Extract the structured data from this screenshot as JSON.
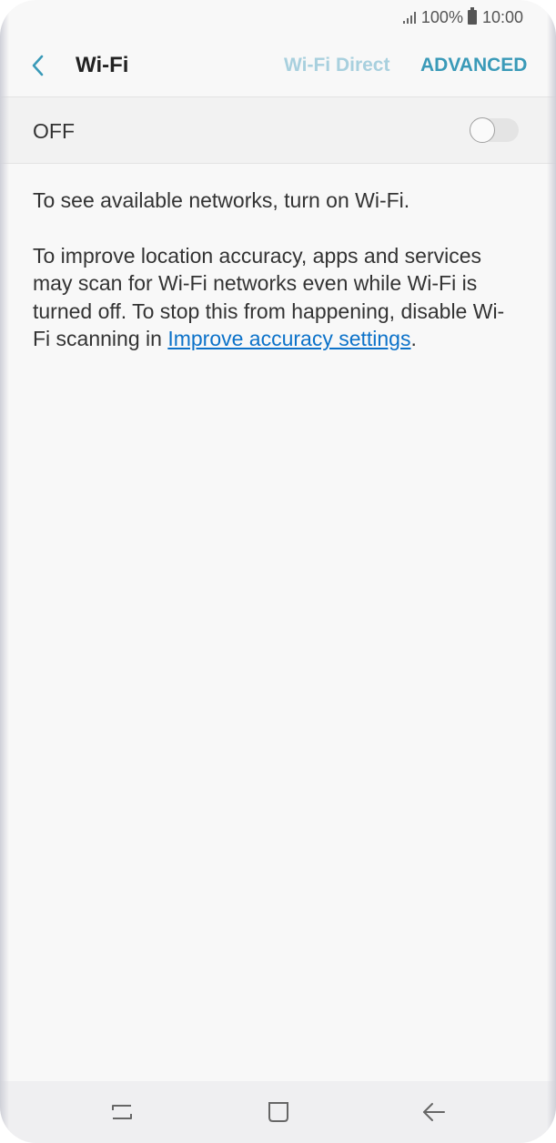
{
  "status_bar": {
    "battery_percent": "100%",
    "time": "10:00"
  },
  "app_bar": {
    "back_icon": "chevron-left-icon",
    "title": "Wi-Fi",
    "wifi_direct_label": "Wi-Fi Direct",
    "advanced_label": "ADVANCED"
  },
  "toggle": {
    "label": "OFF",
    "state": "off"
  },
  "content": {
    "paragraph1": "To see available networks, turn on Wi-Fi.",
    "paragraph2_prefix": "To improve location accuracy, apps and services may scan for Wi-Fi networks even while Wi-Fi is turned off. To stop this from happening, disable Wi-Fi scanning in ",
    "paragraph2_link": "Improve accuracy settings",
    "paragraph2_suffix": "."
  },
  "nav_bar": {
    "recent_icon": "recent-apps-icon",
    "home_icon": "home-icon",
    "back_icon": "back-arrow-icon"
  },
  "colors": {
    "accent": "#3a9ab8",
    "accent_disabled": "#a8d0de",
    "link": "#0c72c9",
    "background": "#f8f8f8"
  }
}
